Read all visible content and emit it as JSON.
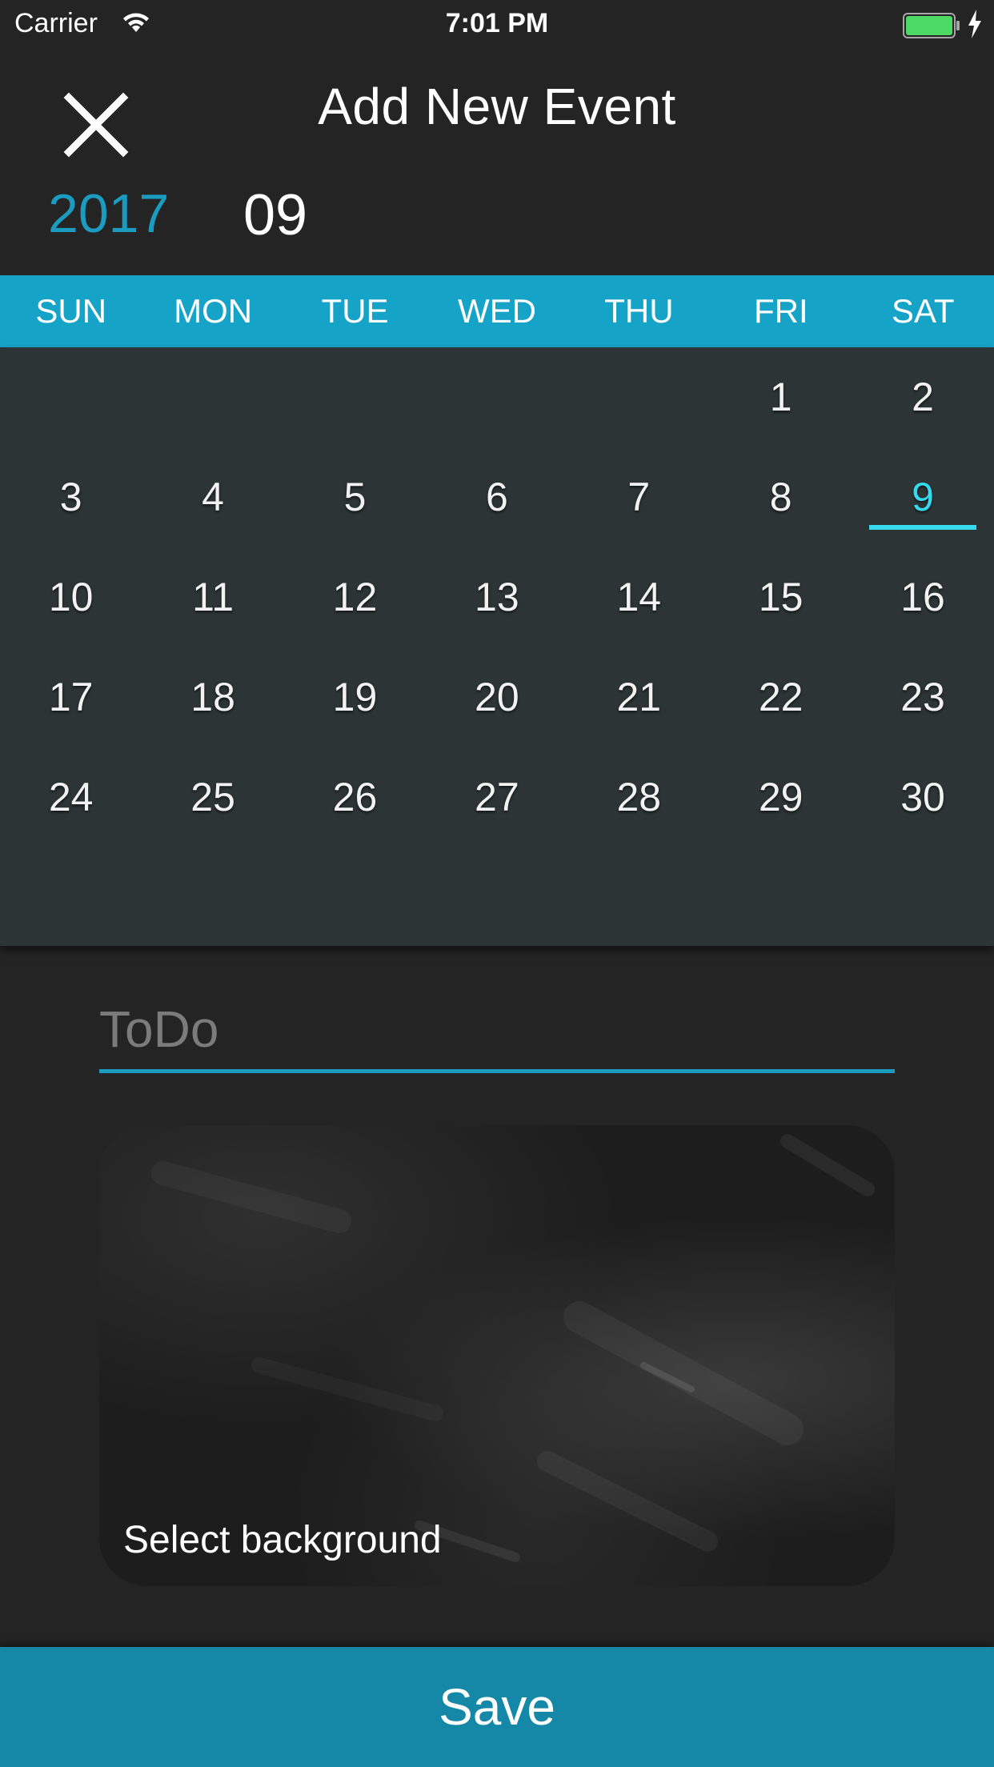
{
  "status_bar": {
    "carrier": "Carrier",
    "time": "7:01 PM",
    "wifi_icon": "wifi-icon",
    "battery_icon": "battery-icon",
    "charging_icon": "charging-bolt-icon"
  },
  "header": {
    "close_icon": "close-icon",
    "title": "Add New Event",
    "year": "2017",
    "month": "09"
  },
  "calendar": {
    "weekdays": [
      "SUN",
      "MON",
      "TUE",
      "WED",
      "THU",
      "FRI",
      "SAT"
    ],
    "weeks": [
      [
        "",
        "",
        "",
        "",
        "",
        "1",
        "2"
      ],
      [
        "3",
        "4",
        "5",
        "6",
        "7",
        "8",
        "9"
      ],
      [
        "10",
        "11",
        "12",
        "13",
        "14",
        "15",
        "16"
      ],
      [
        "17",
        "18",
        "19",
        "20",
        "21",
        "22",
        "23"
      ],
      [
        "24",
        "25",
        "26",
        "27",
        "28",
        "29",
        "30"
      ]
    ],
    "selected_day": "9"
  },
  "form": {
    "todo_placeholder": "ToDo",
    "todo_value": "",
    "background_label": "Select background"
  },
  "footer": {
    "save_label": "Save"
  },
  "colors": {
    "accent": "#1a9bbf",
    "weekday_bar": "#16a3c8",
    "selected_day": "#37d9ee",
    "save_button": "#1488a6",
    "background": "#242424",
    "calendar_bg": "#2c3435"
  }
}
